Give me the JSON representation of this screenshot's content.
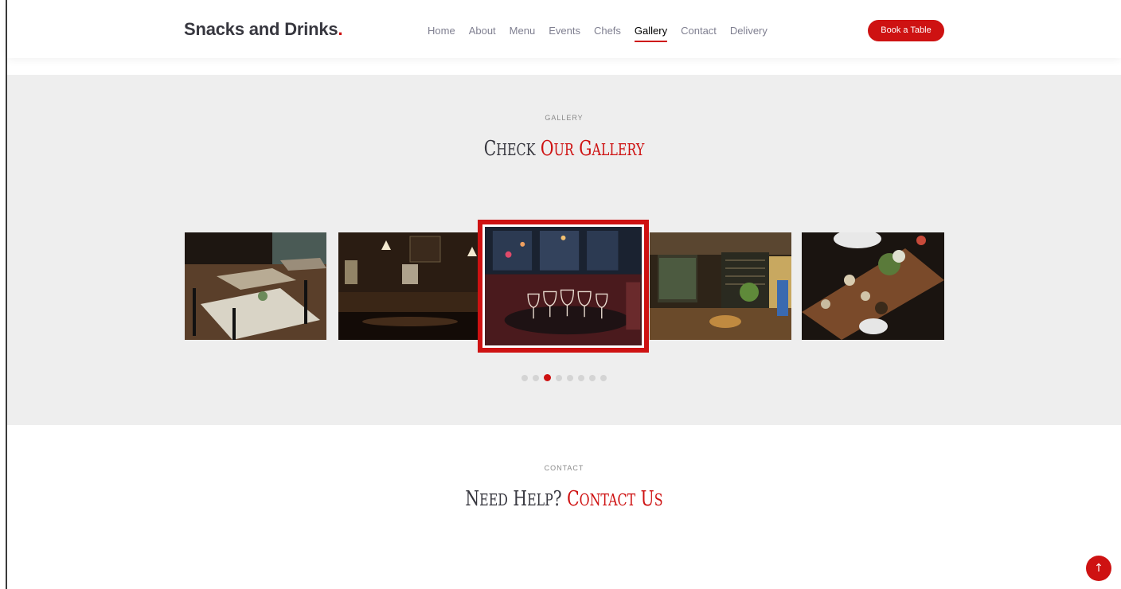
{
  "header": {
    "logo_text": "Snacks and Drinks",
    "logo_dot": ".",
    "nav": [
      {
        "label": "Home",
        "active": false
      },
      {
        "label": "About",
        "active": false
      },
      {
        "label": "Menu",
        "active": false
      },
      {
        "label": "Events",
        "active": false
      },
      {
        "label": "Chefs",
        "active": false
      },
      {
        "label": "Gallery",
        "active": true
      },
      {
        "label": "Contact",
        "active": false
      },
      {
        "label": "Delivery",
        "active": false
      }
    ],
    "book_button": "Book a Table"
  },
  "gallery": {
    "label": "GALLERY",
    "title_plain": "Check ",
    "title_accent": "Our Gallery",
    "images": [
      {
        "name": "restaurant-tables-image"
      },
      {
        "name": "bar-interior-image"
      },
      {
        "name": "wine-glasses-table-image",
        "active": true
      },
      {
        "name": "cafe-seating-image"
      },
      {
        "name": "overhead-dining-table-image"
      }
    ],
    "pagination": {
      "total": 8,
      "current": 3
    }
  },
  "contact": {
    "label": "CONTACT",
    "title_plain": "Need Help? ",
    "title_accent": "Contact Us"
  },
  "scroll_top_icon": "arrow-up-icon",
  "colors": {
    "accent": "#ce1212",
    "text_dark": "#37373f",
    "nav_text": "#7f7f90",
    "gallery_bg": "#eeeeee"
  }
}
